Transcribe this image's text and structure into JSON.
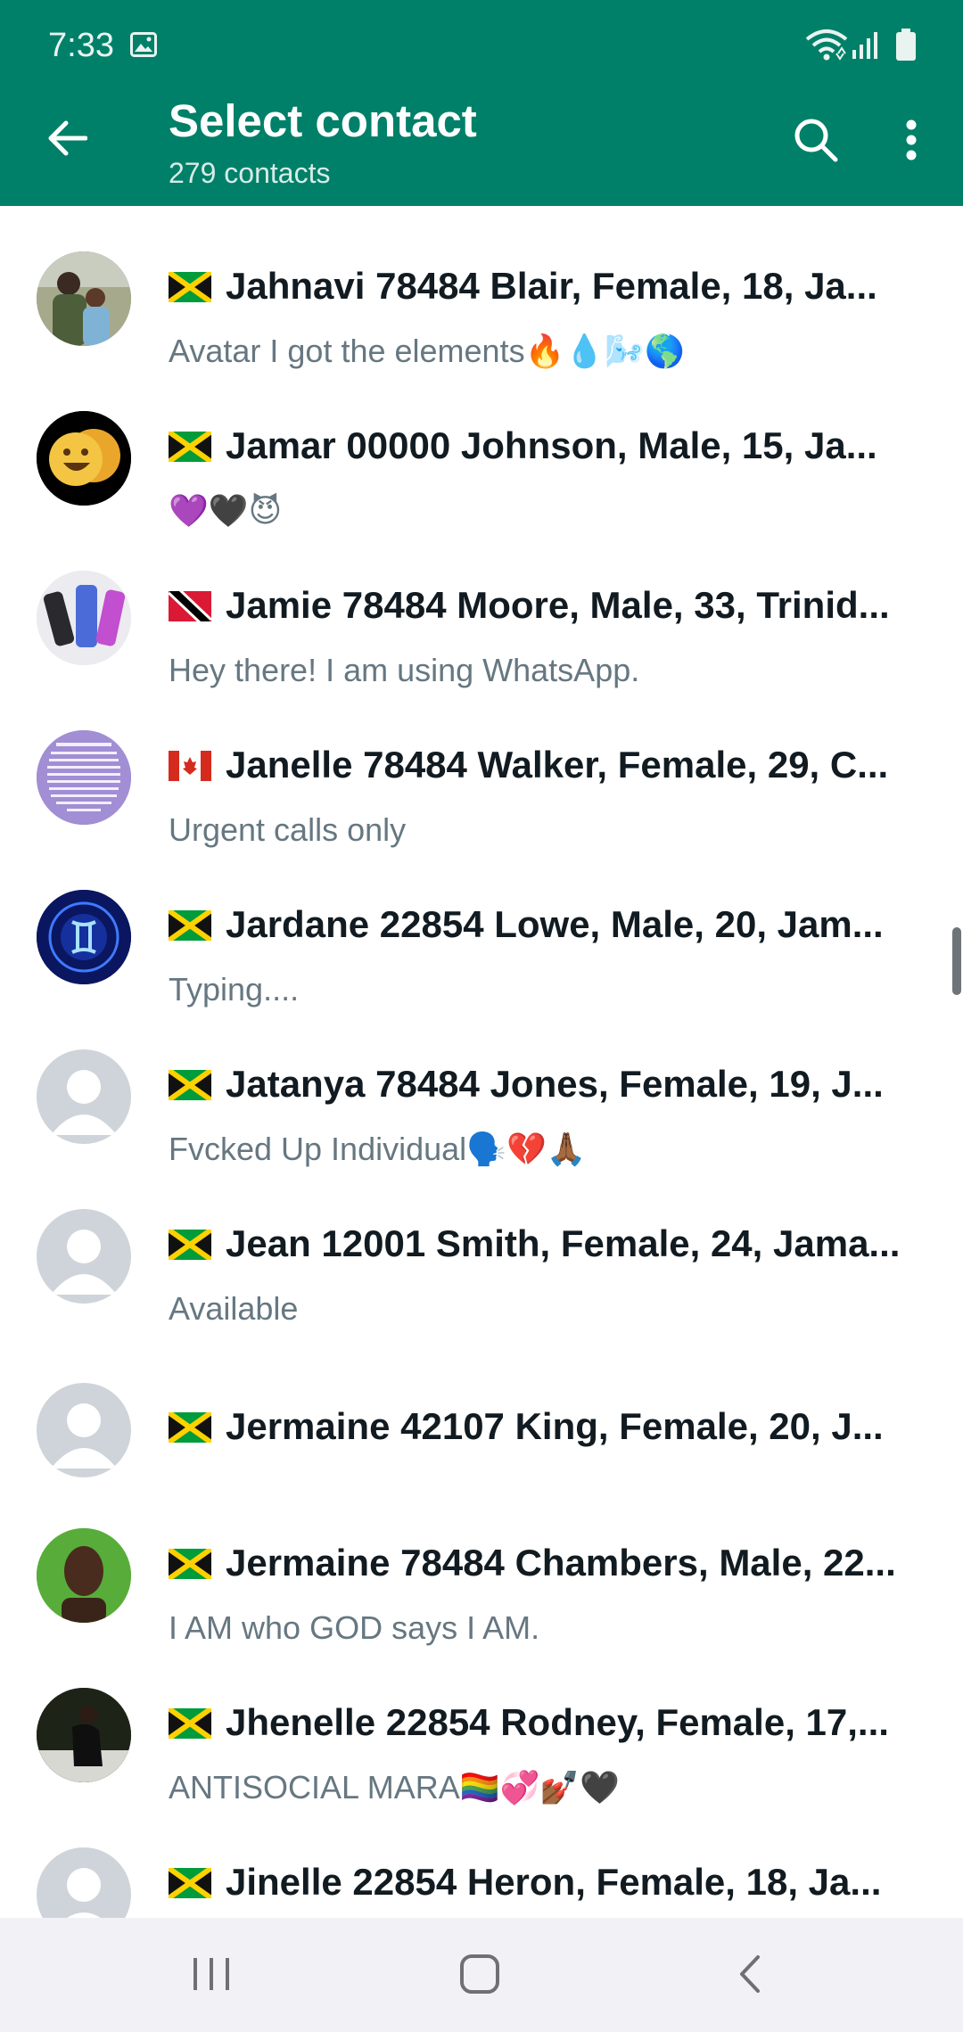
{
  "status_bar": {
    "time": "7:33"
  },
  "header": {
    "title": "Select contact",
    "subtitle": "279 contacts"
  },
  "contacts": [
    {
      "flag": "jamaica",
      "name": "Jahnavi 78484 Blair, Female, 18, Ja...",
      "status": "Avatar I got the elements🔥💧🌬️🌎"
    },
    {
      "flag": "jamaica",
      "name": "Jamar 00000 Johnson, Male, 15, Ja...",
      "status": "💜🖤😈"
    },
    {
      "flag": "trinidad",
      "name": "Jamie 78484 Moore, Male, 33, Trinid...",
      "status": "Hey there! I am using WhatsApp."
    },
    {
      "flag": "canada",
      "name": "Janelle 78484 Walker, Female, 29, C...",
      "status": "Urgent calls only"
    },
    {
      "flag": "jamaica",
      "name": "Jardane 22854 Lowe, Male, 20, Jam...",
      "status": "Typing...."
    },
    {
      "flag": "jamaica",
      "name": "Jatanya 78484 Jones, Female, 19, J...",
      "status": "Fvcked Up Individual🗣️💔🙏🏾"
    },
    {
      "flag": "jamaica",
      "name": "Jean 12001 Smith, Female, 24, Jama...",
      "status": "Available"
    },
    {
      "flag": "jamaica",
      "name": "Jermaine 42107 King, Female, 20, J...",
      "status": ""
    },
    {
      "flag": "jamaica",
      "name": "Jermaine 78484 Chambers, Male, 22...",
      "status": "I AM who GOD says I AM."
    },
    {
      "flag": "jamaica",
      "name": "Jhenelle 22854 Rodney, Female, 17,...",
      "status": "ANTISOCIAL MARA🏳️‍🌈💞💅🏾🖤"
    },
    {
      "flag": "jamaica",
      "name": "Jinelle 22854 Heron, Female, 18, Ja...",
      "status": ""
    }
  ]
}
